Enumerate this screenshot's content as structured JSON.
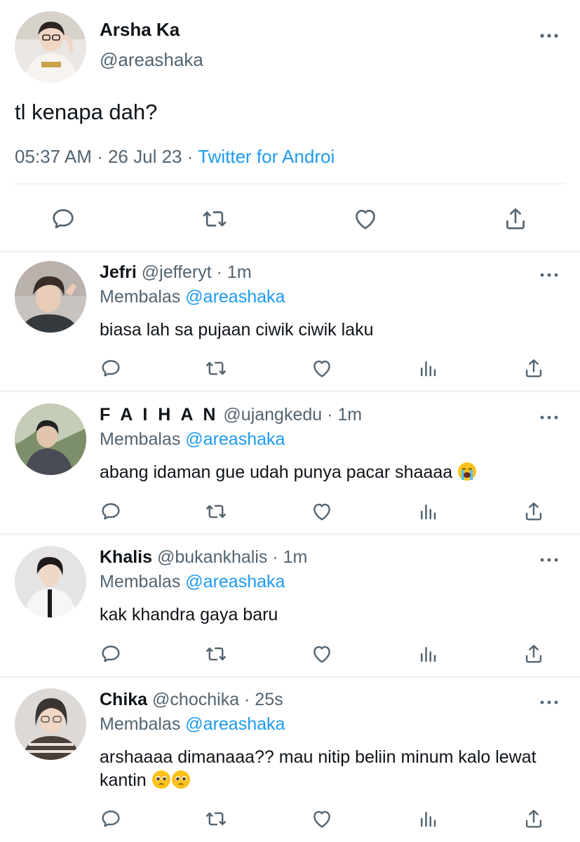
{
  "main_tweet": {
    "name": "Arsha Ka",
    "handle": "@areashaka",
    "text": "tl kenapa dah?",
    "time": "05:37 AM",
    "date": "26 Jul 23",
    "separator": " · ",
    "source": "Twitter for Androi",
    "actions": [
      "reply-icon",
      "retweet-icon",
      "like-icon",
      "share-icon"
    ]
  },
  "replies": [
    {
      "name": "Jefri",
      "handle": "@jefferyt · 1m",
      "replying_label": "Membalas",
      "replying_to": "@areashaka",
      "text": "biasa lah sa pujaan ciwik ciwik laku",
      "emoji": []
    },
    {
      "name": "F A I H A N",
      "handle": "@ujangkedu · 1m",
      "replying_label": "Membalas",
      "replying_to": "@areashaka",
      "text": "abang idaman gue udah punya pacar shaaaa",
      "emoji": [
        "loudly-crying-face-emoji"
      ]
    },
    {
      "name": "Khalis",
      "handle": "@bukankhalis · 1m",
      "replying_label": "Membalas",
      "replying_to": "@areashaka",
      "text": "kak khandra gaya baru",
      "emoji": []
    },
    {
      "name": "Chika",
      "handle": "@chochika · 25s",
      "replying_label": "Membalas",
      "replying_to": "@areashaka",
      "text": "arshaaaa dimanaaa?? mau nitip beliin minum kalo lewat kantin",
      "emoji": [
        "pleading-face-emoji",
        "pleading-face-emoji"
      ]
    }
  ],
  "colors": {
    "text": "#0f1419",
    "secondary": "#536471",
    "accent": "#1d9bf0",
    "divider": "#eff3f4"
  }
}
